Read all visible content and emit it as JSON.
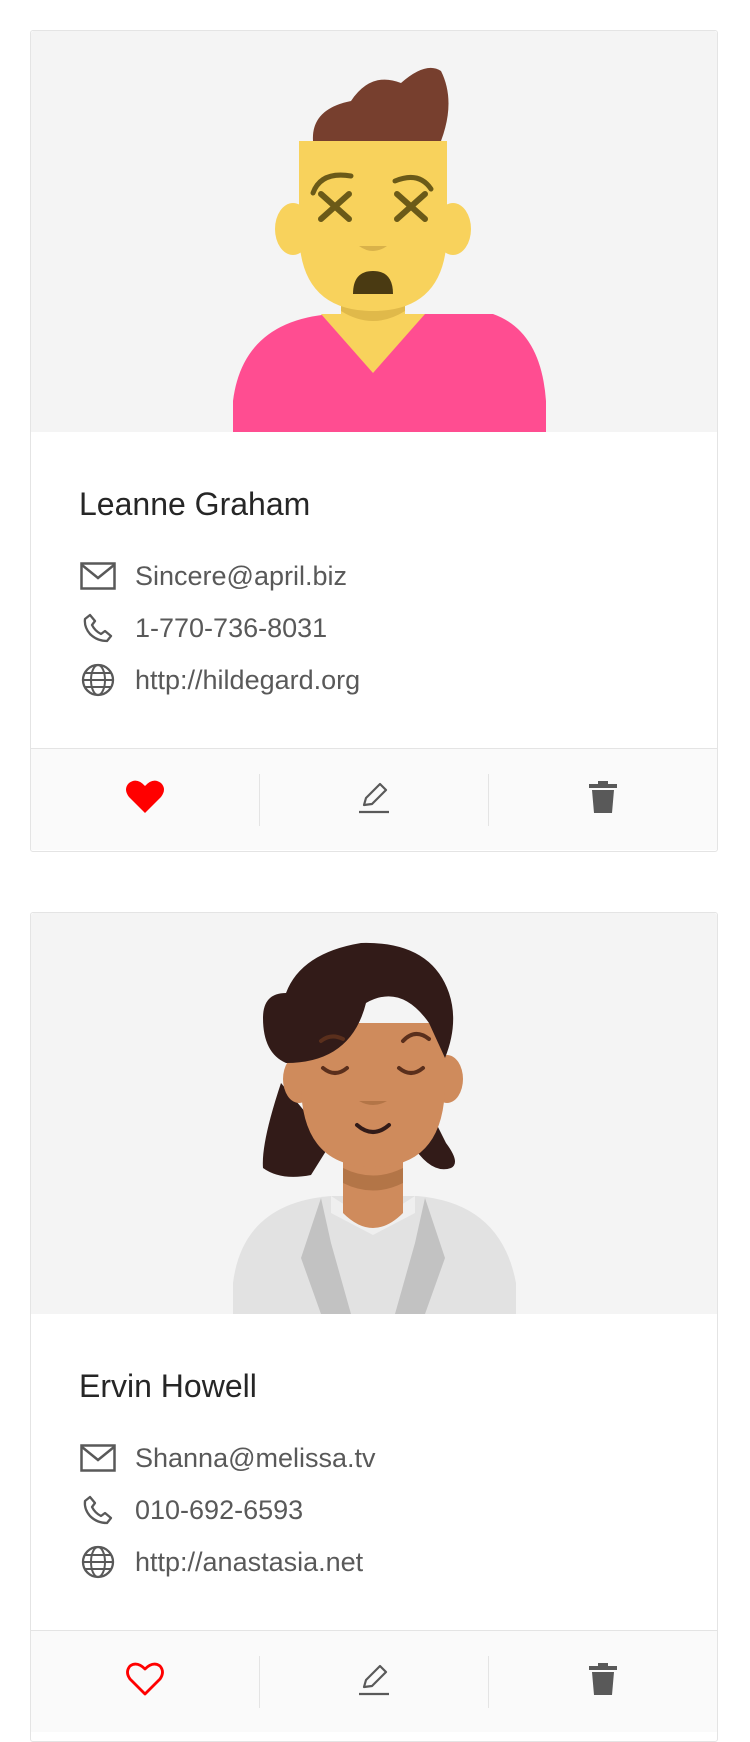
{
  "users": [
    {
      "name": "Leanne Graham",
      "email": "Sincere@april.biz",
      "phone": "1-770-736-8031",
      "website": "http://hildegard.org",
      "liked": true,
      "avatar": "dizzy-man-avatar"
    },
    {
      "name": "Ervin Howell",
      "email": "Shanna@melissa.tv",
      "phone": "010-692-6593",
      "website": "http://anastasia.net",
      "liked": false,
      "avatar": "woman-avatar"
    }
  ],
  "icons": {
    "email": "mail-icon",
    "phone": "phone-icon",
    "website": "globe-icon",
    "like": "heart-icon",
    "edit": "edit-icon",
    "delete": "delete-icon"
  },
  "colors": {
    "like": "#ff0000",
    "icon": "#595959",
    "cover": "#f4f4f4",
    "border": "#e4e4e4"
  }
}
